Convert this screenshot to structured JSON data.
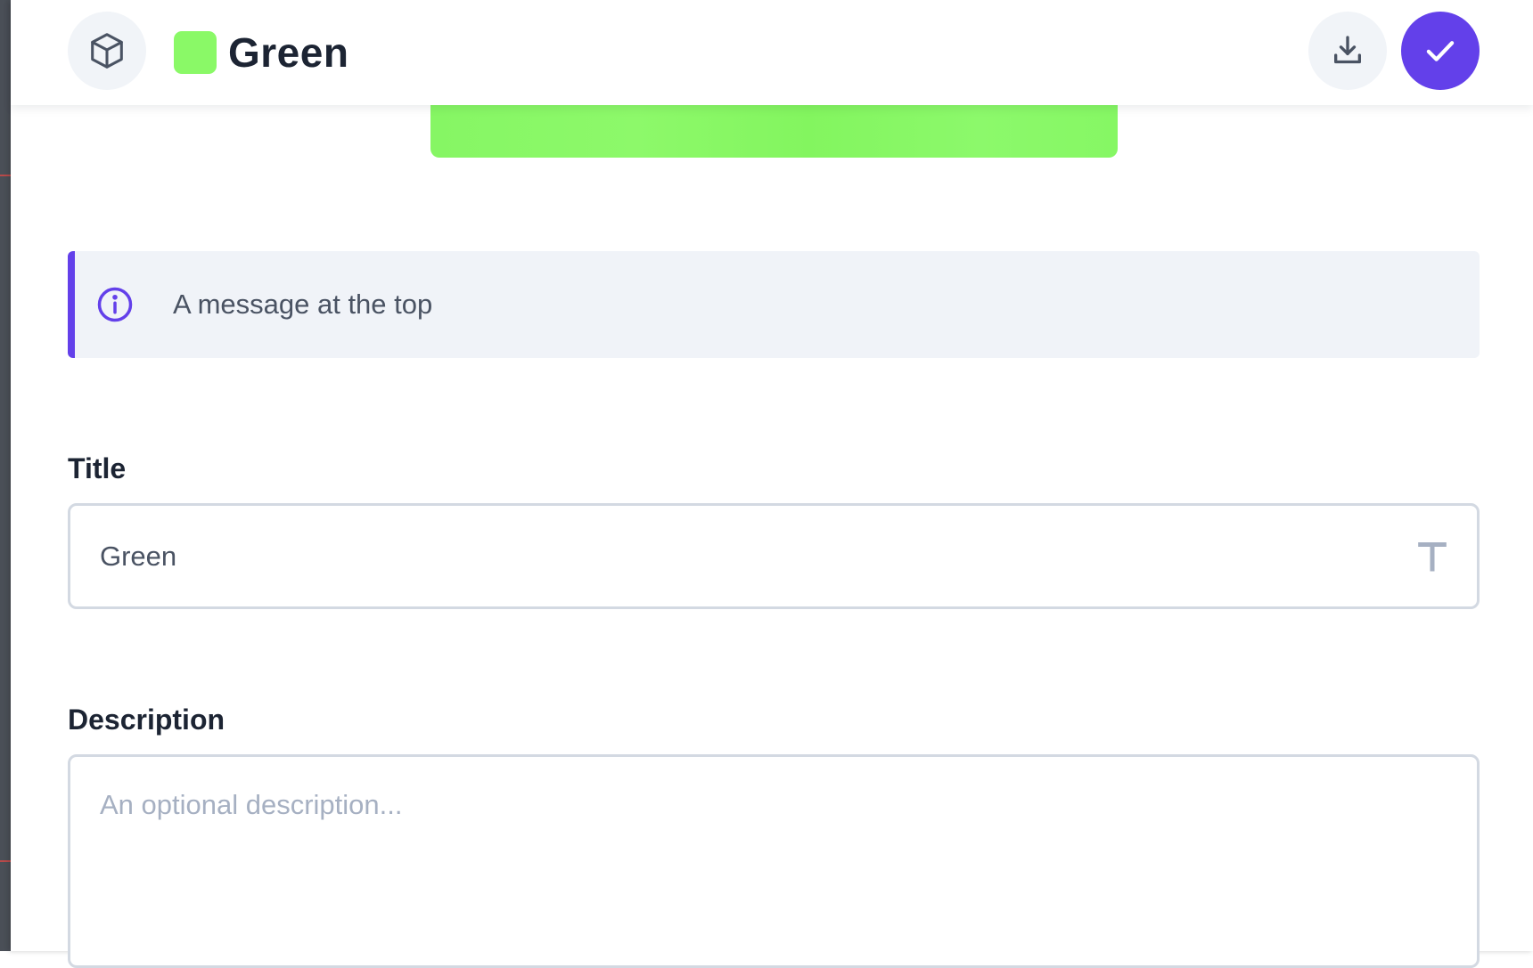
{
  "header": {
    "title": "Green",
    "swatch_color": "#8af967",
    "left_icon": "cube-icon",
    "download_icon": "download-icon",
    "confirm_icon": "check-icon",
    "accent_color": "#6340ea"
  },
  "banner": {
    "color": "#8af967"
  },
  "info": {
    "icon": "info-icon",
    "message": "A message at the top"
  },
  "form": {
    "title_label": "Title",
    "title_value": "Green",
    "title_type_icon": "text-type-icon",
    "description_label": "Description",
    "description_value": "",
    "description_placeholder": "An optional description..."
  }
}
